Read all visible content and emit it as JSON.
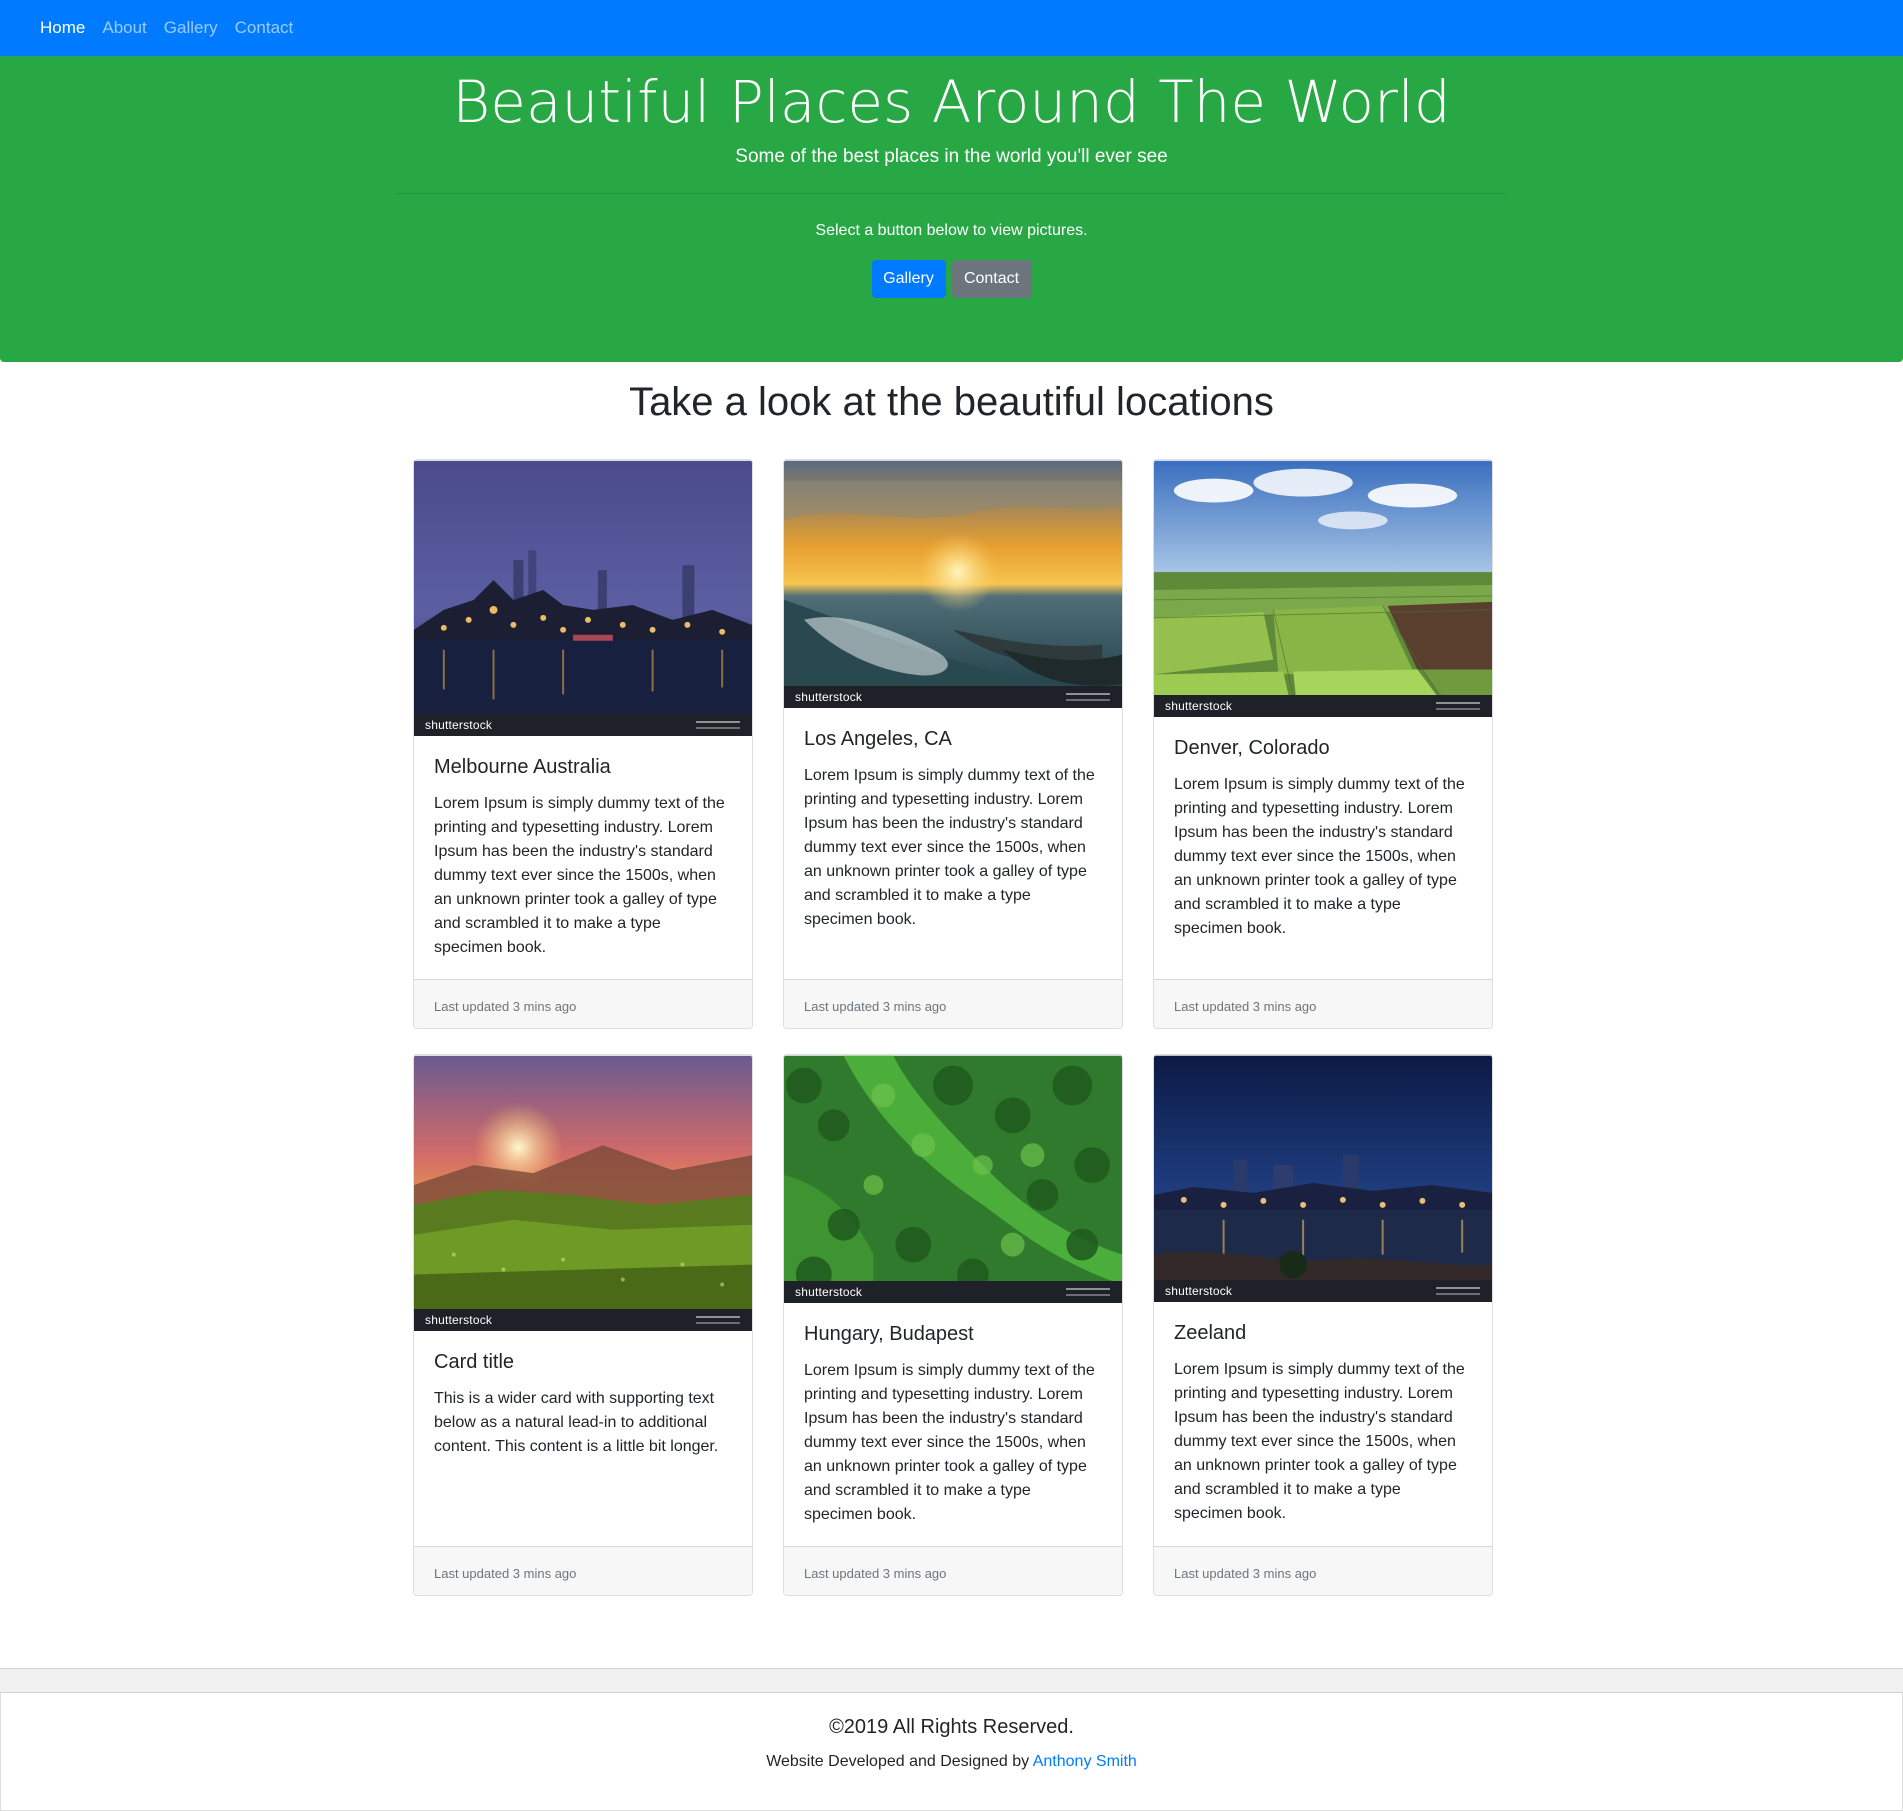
{
  "nav": {
    "items": [
      {
        "label": "Home"
      },
      {
        "label": "About"
      },
      {
        "label": "Gallery"
      },
      {
        "label": "Contact"
      }
    ]
  },
  "hero": {
    "title": "Beautiful Places Around The World",
    "subtitle": "Some of the best places in the world you'll ever see",
    "lead": "Select a button below to view pictures.",
    "gallery_button": "Gallery",
    "contact_button": "Contact"
  },
  "section": {
    "title": "Take a look at the beautiful locations"
  },
  "watermark": "shutterstock",
  "cards": [
    {
      "title": "Melbourne Australia",
      "text": "Lorem Ipsum is simply dummy text of the printing and typesetting industry. Lorem Ipsum has been the industry's standard dummy text ever since the 1500s, when an unknown printer took a galley of type and scrambled it to make a type specimen book.",
      "footer": "Last updated 3 mins ago"
    },
    {
      "title": "Los Angeles, CA",
      "text": "Lorem Ipsum is simply dummy text of the printing and typesetting industry. Lorem Ipsum has been the industry's standard dummy text ever since the 1500s, when an unknown printer took a galley of type and scrambled it to make a type specimen book.",
      "footer": "Last updated 3 mins ago"
    },
    {
      "title": "Denver, Colorado",
      "text": "Lorem Ipsum is simply dummy text of the printing and typesetting industry. Lorem Ipsum has been the industry's standard dummy text ever since the 1500s, when an unknown printer took a galley of type and scrambled it to make a type specimen book.",
      "footer": "Last updated 3 mins ago"
    },
    {
      "title": "Card title",
      "text": "This is a wider card with supporting text below as a natural lead-in to additional content. This content is a little bit longer.",
      "footer": "Last updated 3 mins ago"
    },
    {
      "title": "Hungary, Budapest",
      "text": "Lorem Ipsum is simply dummy text of the printing and typesetting industry. Lorem Ipsum has been the industry's standard dummy text ever since the 1500s, when an unknown printer took a galley of type and scrambled it to make a type specimen book.",
      "footer": "Last updated 3 mins ago"
    },
    {
      "title": "Zeeland",
      "text": "Lorem Ipsum is simply dummy text of the printing and typesetting industry. Lorem Ipsum has been the industry's standard dummy text ever since the 1500s, when an unknown printer took a galley of type and scrambled it to make a type specimen book.",
      "footer": "Last updated 3 mins ago"
    }
  ],
  "footer": {
    "copyright": "©2019 All Rights Reserved.",
    "credit_prefix": "Website Developed and Designed by ",
    "credit_name": "Anthony Smith"
  },
  "colors": {
    "navbar": "#007bff",
    "hero": "#28a745",
    "primary": "#007bff",
    "secondary": "#6c757d"
  }
}
